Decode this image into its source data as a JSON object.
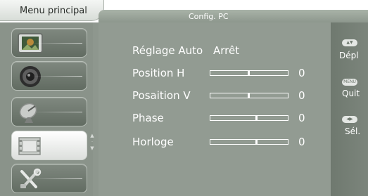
{
  "header": {
    "menu_title": "Menu principal",
    "page_title": "Config. PC"
  },
  "sidebar": {
    "items": [
      {
        "name": "picture",
        "icon": "picture-icon",
        "active": false
      },
      {
        "name": "sound",
        "icon": "speaker-icon",
        "active": false
      },
      {
        "name": "channel",
        "icon": "satellite-dish-icon",
        "active": false
      },
      {
        "name": "pc-setup",
        "icon": "film-frame-icon",
        "active": true
      },
      {
        "name": "settings",
        "icon": "tools-icon",
        "active": false
      }
    ]
  },
  "settings": {
    "auto": {
      "label": "Réglage Auto",
      "value": "Arrêt"
    },
    "rows": [
      {
        "label": "Position H",
        "value": "0",
        "level": 0.5
      },
      {
        "label": "Posaition V",
        "value": "0",
        "level": 0.5
      },
      {
        "label": "Phase",
        "value": "0",
        "level": 0.6
      },
      {
        "label": "Horloge",
        "value": "0",
        "level": 0.6
      }
    ]
  },
  "help": {
    "move": {
      "key": "▲▼",
      "label": "Dépl"
    },
    "quit": {
      "key": "MENU",
      "label": "Quit"
    },
    "select": {
      "key": "◀▶",
      "label": "Sél."
    }
  },
  "colors": {
    "panel": "#929b92",
    "active_item": "#ffffff",
    "text": "#ffffff"
  }
}
